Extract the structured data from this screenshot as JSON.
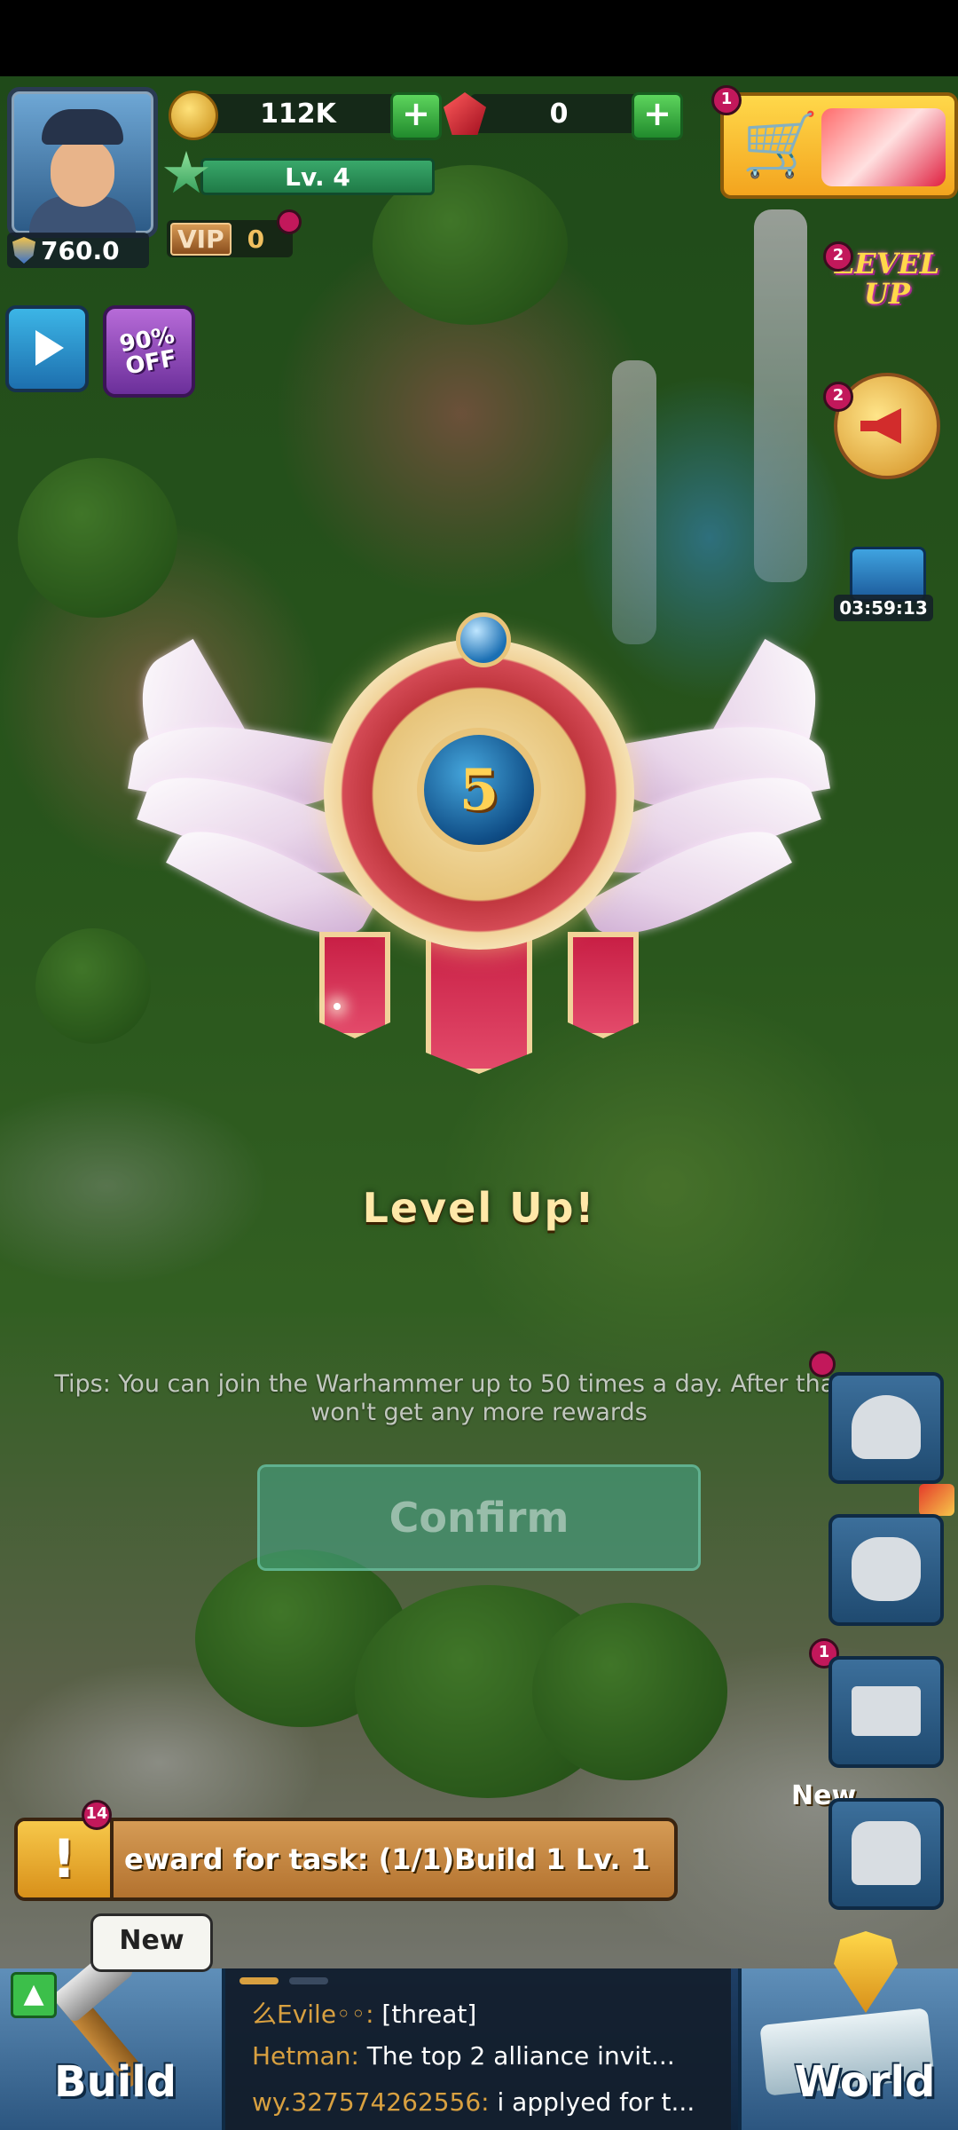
{
  "hud": {
    "power": "760.0",
    "gold": "112K",
    "gems": "0",
    "level": "Lv. 4",
    "vip_label": "VIP",
    "vip_level": "0",
    "shop_badge": "1",
    "discount_label": "90% OFF"
  },
  "side_events": {
    "levelup_badge_text": "LEVEL UP",
    "levelup_count": "2",
    "announce_count": "2",
    "chest_timer": "03:59:13"
  },
  "popup": {
    "level_number": "5",
    "title": "Level Up!",
    "tips": "Tips: You can join the Warhammer up to 50 times a day. After that, you won't get any more rewards",
    "confirm_label": "Confirm"
  },
  "right_menu": {
    "mail_count": "1",
    "new_tag": "New"
  },
  "task": {
    "count": "14",
    "text": "eward for task: (1/1)Build 1 Lv. 1"
  },
  "bottom": {
    "build_label": "Build",
    "build_new": "New",
    "world_label": "World",
    "chat": [
      {
        "name": "么Evile◦◦:",
        "message": "[threat]"
      },
      {
        "name": "Hetman:",
        "message": "The top 2 alliance invit..."
      },
      {
        "name": "wy.327574262556:",
        "message": "i applyed for t..."
      }
    ]
  },
  "colors": {
    "accent_gold": "#ffd84a",
    "confirm_teal": "#46aa8c",
    "badge_red": "#c2185b"
  }
}
